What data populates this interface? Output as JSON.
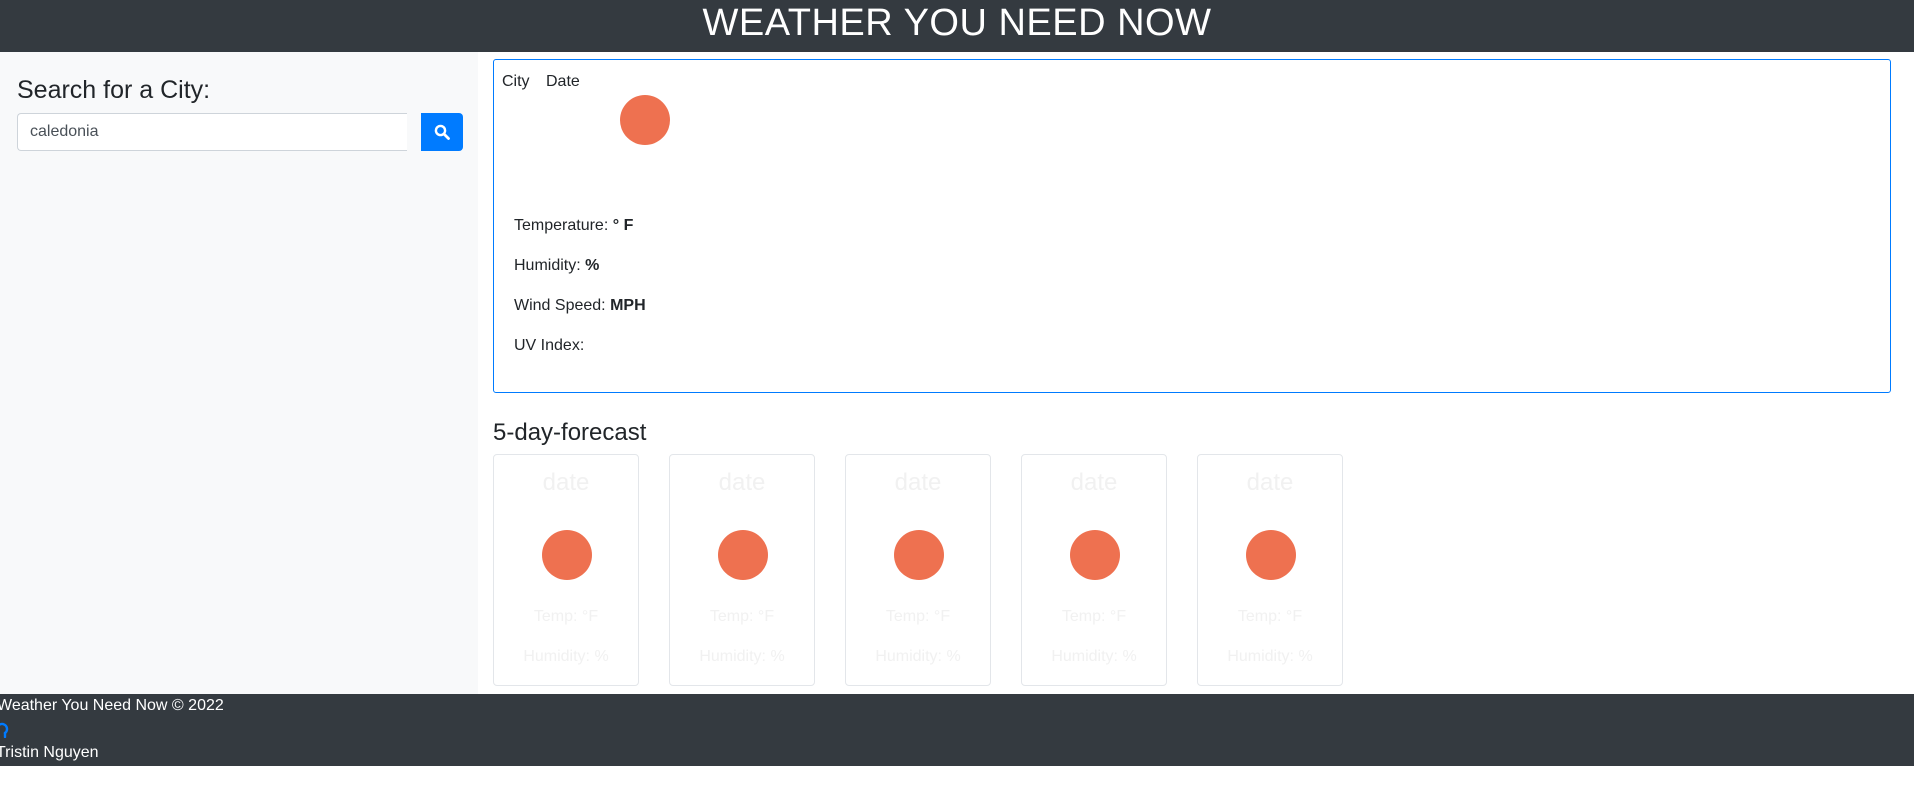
{
  "header": {
    "title": "WEATHER YOU NEED NOW"
  },
  "sidebar": {
    "title": "Search for a City:",
    "search": {
      "value": "caledonia",
      "placeholder": ""
    },
    "search_button_icon": "search-icon"
  },
  "current": {
    "city": "City",
    "date": "Date",
    "icon": "weather-icon",
    "temperature_label": "Temperature:",
    "temperature_unit": "° F",
    "humidity_label": "Humidity:",
    "humidity_unit": "%",
    "wind_label": "Wind Speed:",
    "wind_unit": "MPH",
    "uv_label": "UV Index:"
  },
  "forecast": {
    "title": "5-day-forecast",
    "cards": [
      {
        "date": "date",
        "temp": "Temp: °F",
        "humidity": "Humidity: %"
      },
      {
        "date": "date",
        "temp": "Temp: °F",
        "humidity": "Humidity: %"
      },
      {
        "date": "date",
        "temp": "Temp: °F",
        "humidity": "Humidity: %"
      },
      {
        "date": "date",
        "temp": "Temp: °F",
        "humidity": "Humidity: %"
      },
      {
        "date": "date",
        "temp": "Temp: °F",
        "humidity": "Humidity: %"
      }
    ]
  },
  "footer": {
    "copyright": "Weather You Need Now © 2022",
    "github_icon": "github-icon",
    "author": "Tristin Nguyen"
  },
  "colors": {
    "header_bg": "#343a40",
    "accent": "#007bff",
    "weather_icon": "#ee7150",
    "sidebar_bg": "#f8f9fa"
  }
}
